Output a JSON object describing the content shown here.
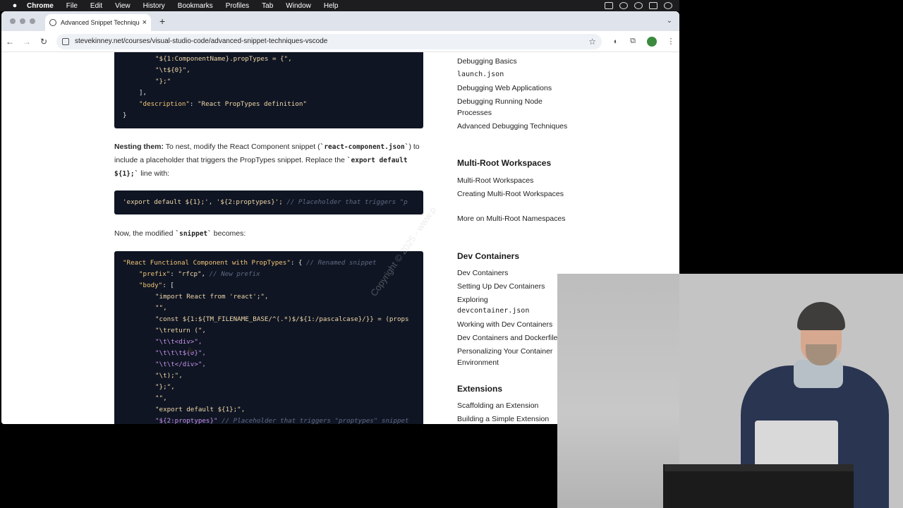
{
  "menubar": {
    "app": "Chrome",
    "items": [
      "File",
      "Edit",
      "View",
      "History",
      "Bookmarks",
      "Profiles",
      "Tab",
      "Window",
      "Help"
    ]
  },
  "browser": {
    "tab_title": "Advanced Snippet Techniques",
    "url": "stevekinney.net/courses/visual-studio-code/advanced-snippet-techniques-vscode"
  },
  "code1": {
    "line1": "\"${1:ComponentName}.propTypes = {\",",
    "line2": "\"\\t${0}\",",
    "line3": "\"};\"",
    "line4": "],",
    "line5_key": "\"description\"",
    "line5_val": "\"React PropTypes definition\"",
    "line6": "}"
  },
  "para1": {
    "bold": "Nesting them:",
    "t1": " To nest, modify the React Component snippet (",
    "c1": "`react-component.json`",
    "t2": ") to include a placeholder that triggers the PropTypes snippet. Replace the ",
    "c2": "`export default ${1};`",
    "t3": " line with:"
  },
  "code2": {
    "code": "'export default ${1};', '${2:proptypes}'; ",
    "comment": "// Placeholder that triggers \"p"
  },
  "para2": {
    "t1": "Now, the modified ",
    "c1": "`snippet`",
    "t2": " becomes:"
  },
  "code3": {
    "l1_key": "\"React Functional Component with PropTypes\"",
    "l1_rest": ": { ",
    "l1_comment": "// Renamed snippet",
    "l2_key": "\"prefix\"",
    "l2_val": "\"rfcp\"",
    "l2_comment": "// New prefix",
    "l3_key": "\"body\"",
    "l3_rest": ": [",
    "l4": "\"import React from 'react';\",",
    "l5": "\"\",",
    "l6": "\"const ${1:${TM_FILENAME_BASE/^(.*)$/${1:/pascalcase}/}} = (props",
    "l7": "\"\\treturn (\",",
    "l8": "\"\\t\\t<div>\",",
    "l9": "\"\\t\\t\\t${0}\",",
    "l10": "\"\\t\\t</div>\",",
    "l11": "\"\\t);\",",
    "l12": "\"};\",",
    "l13": "\"\",",
    "l14": "\"export default ${1};\",",
    "l15": "\"${2:proptypes}\"",
    "l15_comment": "// Placeholder that triggers \"proptypes\" snippet"
  },
  "sidebar": {
    "debugging": [
      "Debugging Basics",
      "launch.json",
      "Debugging Web Applications",
      "Debugging Running Node Processes",
      "Advanced Debugging Techniques"
    ],
    "multi_root_heading": "Multi-Root Workspaces",
    "multi_root": [
      "Multi-Root Workspaces",
      "Creating Multi-Root Workspaces",
      "More on Multi-Root Namespaces"
    ],
    "dev_containers_heading": "Dev Containers",
    "dev_containers": [
      "Dev Containers",
      "Setting Up Dev Containers",
      "Exploring",
      "devcontainer.json",
      "Working with Dev Containers",
      "Dev Containers and Dockerfiles",
      "Personalizing Your Container Environment"
    ],
    "extensions_heading": "Extensions",
    "extensions": [
      "Scaffolding an Extension",
      "Building a Simple Extension"
    ]
  },
  "watermark": "Copyright © 2025 - www.p"
}
